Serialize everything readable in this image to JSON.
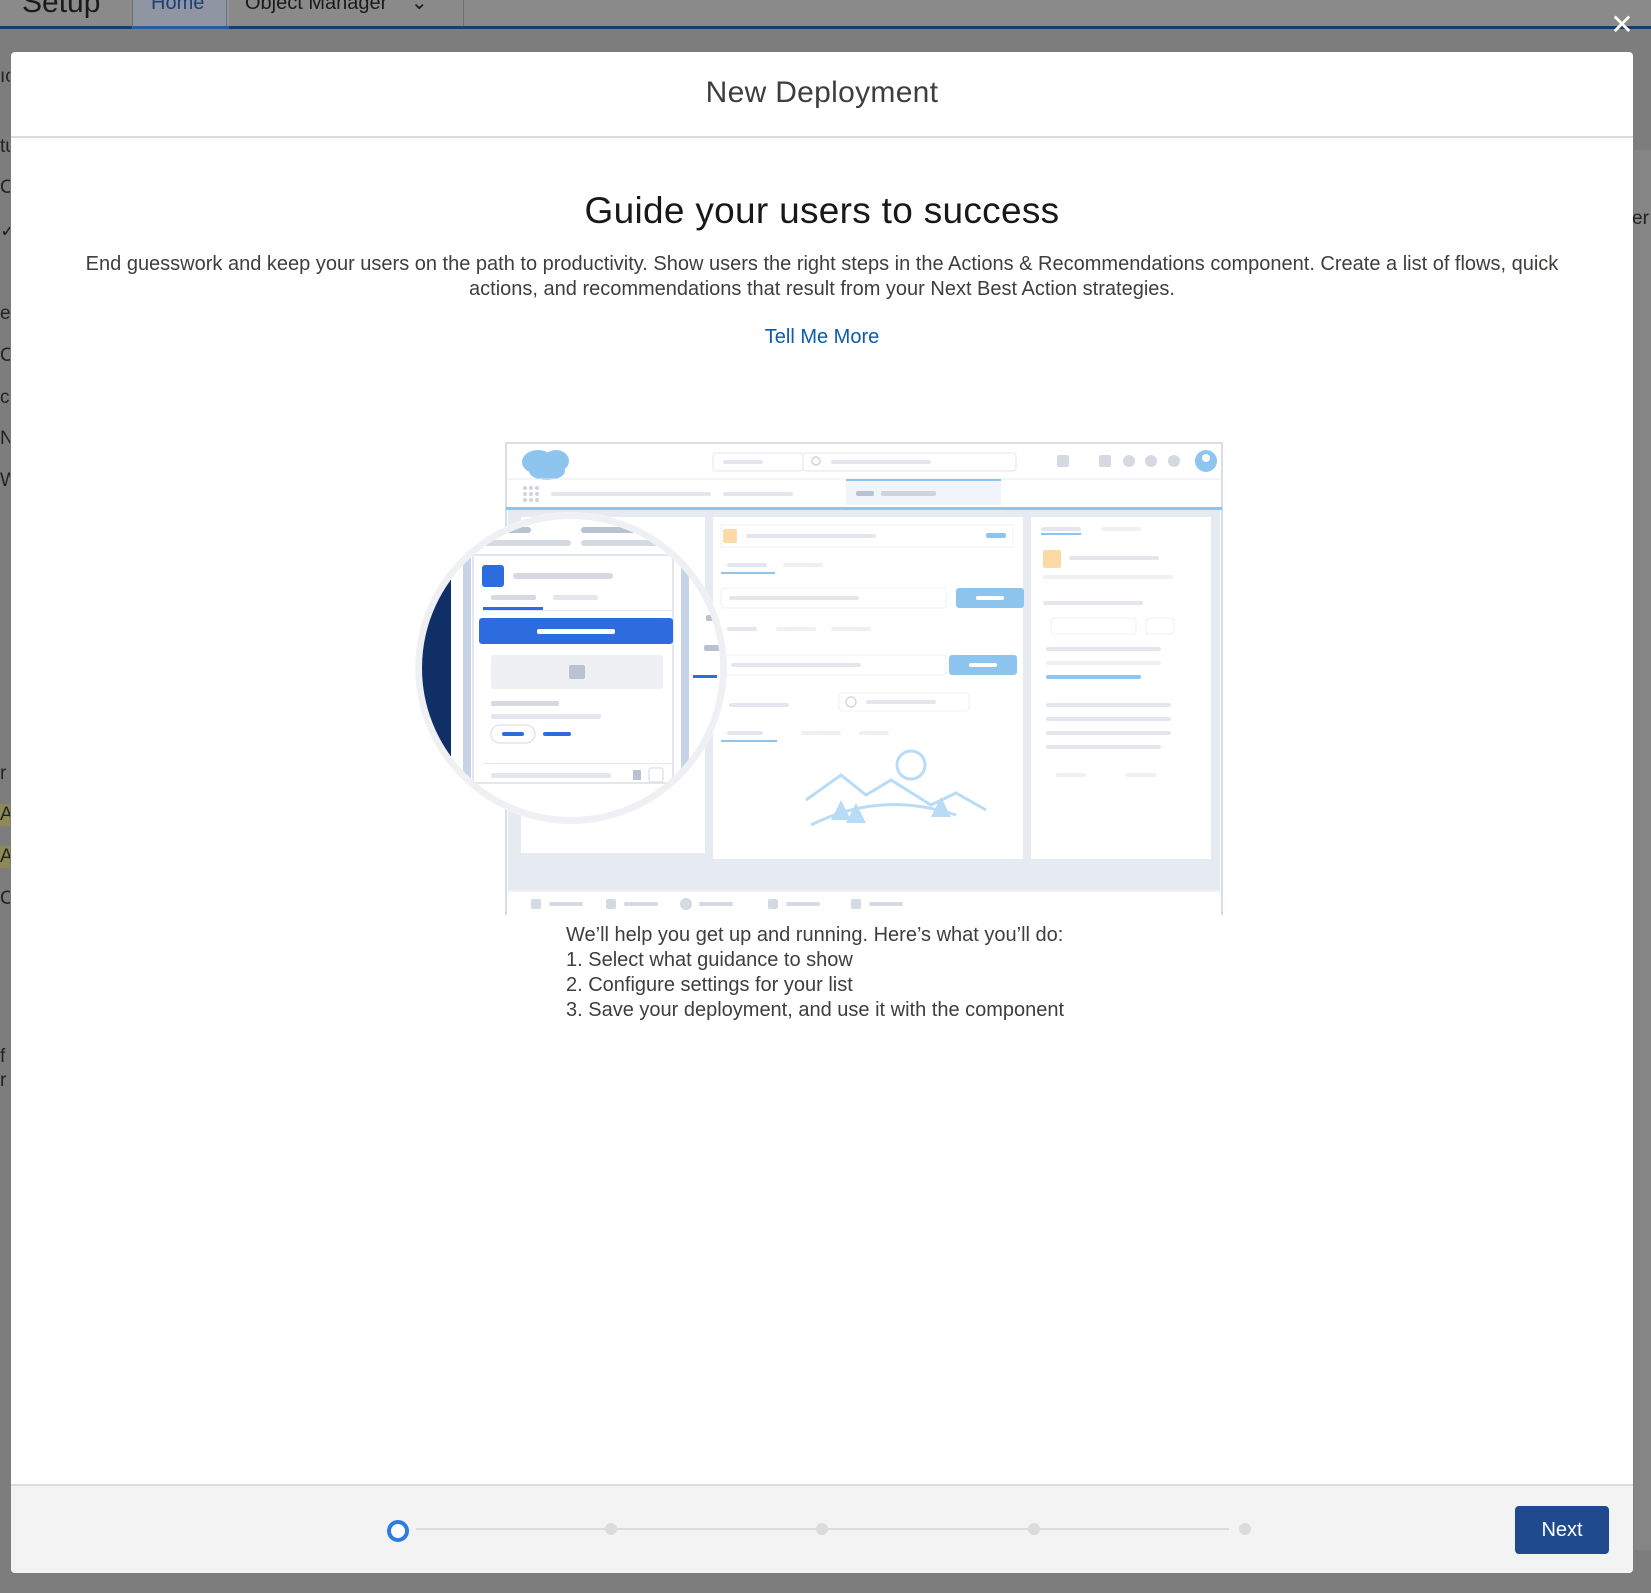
{
  "background": {
    "app_name": "Setup",
    "tabs": [
      {
        "label": "Home"
      },
      {
        "label": "Object Manager"
      }
    ],
    "close_glyph": "✕",
    "left_fragments": [
      "ıc",
      "tu",
      "C",
      "✓",
      "e",
      "C",
      "ce",
      "N",
      "W",
      "r",
      "A",
      "A",
      "C",
      "f",
      "r"
    ],
    "right_fragment": "er"
  },
  "modal": {
    "title": "New Deployment",
    "heading": "Guide your users to success",
    "intro": "End guesswork and keep your users on the path to productivity. Show users the right steps in the Actions & Recommendations component. Create a list of flows, quick actions, and recommendations that result from your Next Best Action strategies.",
    "tell_me_more": "Tell Me More",
    "steps": {
      "intro": "We’ll help you get up and running. Here’s what you’ll do:",
      "items": [
        "1. Select what guidance to show",
        "2. Configure settings for your list",
        "3. Save your deployment, and use it with the component"
      ]
    },
    "footer": {
      "next_label": "Next",
      "progress": {
        "current_step": 1,
        "total_steps": 5
      }
    }
  },
  "colors": {
    "accent": "#1f4b8e",
    "link": "#0b5cab",
    "progress_active": "#2d7ce0",
    "illustration_blue": "#2d6cdf",
    "illustration_navy": "#0f2f66"
  }
}
